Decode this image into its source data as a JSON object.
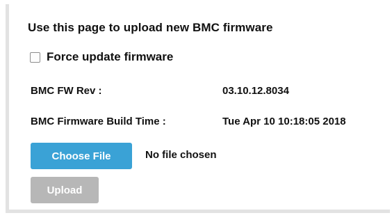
{
  "panel": {
    "heading": "Use this page to upload new BMC firmware",
    "force_update": {
      "label": "Force update firmware",
      "checked": false
    },
    "fw_rev": {
      "label": "BMC FW Rev :",
      "value": "03.10.12.8034"
    },
    "build_time": {
      "label": "BMC Firmware Build Time :",
      "value": "Tue Apr 10 10:18:05 2018"
    },
    "choose_file": {
      "button_label": "Choose File",
      "status": "No file chosen"
    },
    "upload": {
      "button_label": "Upload",
      "enabled": false
    }
  },
  "colors": {
    "choose_button_bg": "#3aa2d6",
    "upload_button_disabled_bg": "#b7b7b7",
    "panel_border": "#e2e2e2"
  }
}
